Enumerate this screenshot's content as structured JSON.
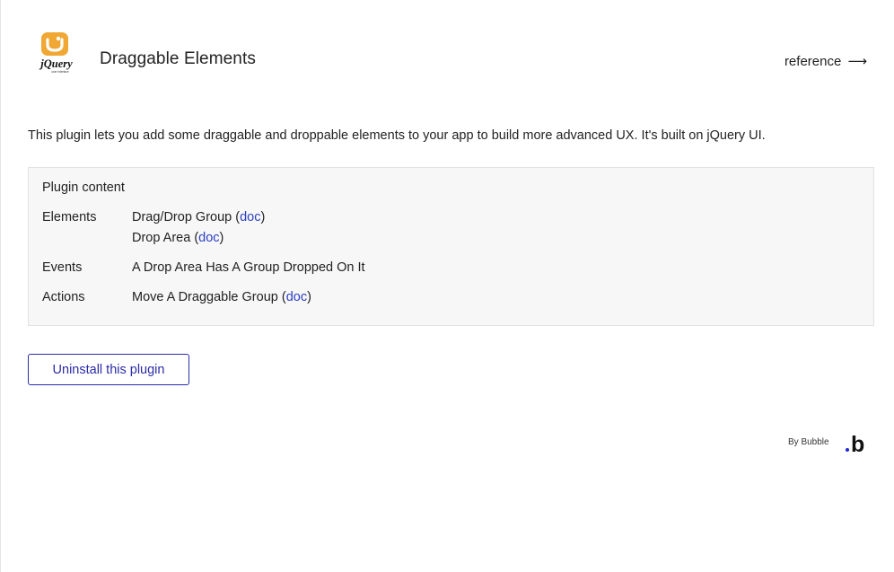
{
  "header": {
    "title": "Draggable Elements",
    "logo_text": "jQuery",
    "logo_subtext": "user interface",
    "reference_label": "reference",
    "reference_arrow": "⟶"
  },
  "description": "This plugin lets you add some draggable and droppable elements to your app to build more advanced UX. It's built on jQuery UI.",
  "plugin_content": {
    "title": "Plugin content",
    "rows": [
      {
        "label": "Elements",
        "items": [
          {
            "text": "Drag/Drop Group",
            "link": "doc"
          },
          {
            "text": "Drop Area",
            "link": "doc"
          }
        ]
      },
      {
        "label": "Events",
        "items": [
          {
            "text": "A Drop Area Has A Group Dropped On It",
            "link": ""
          }
        ]
      },
      {
        "label": "Actions",
        "items": [
          {
            "text": "Move A Draggable Group",
            "link": "doc"
          }
        ]
      }
    ]
  },
  "uninstall_label": "Uninstall this plugin",
  "footer": {
    "by_label": "By Bubble",
    "logo_letter": "b"
  },
  "colors": {
    "accent": "#2b2ba8",
    "link": "#2b3fc4",
    "jquery_orange": "#f0a733",
    "bubble_dot": "#1f28d6"
  },
  "icons": {
    "jquery_logo": "jquery-ui-logo",
    "bubble_logo": "bubble-logo"
  }
}
